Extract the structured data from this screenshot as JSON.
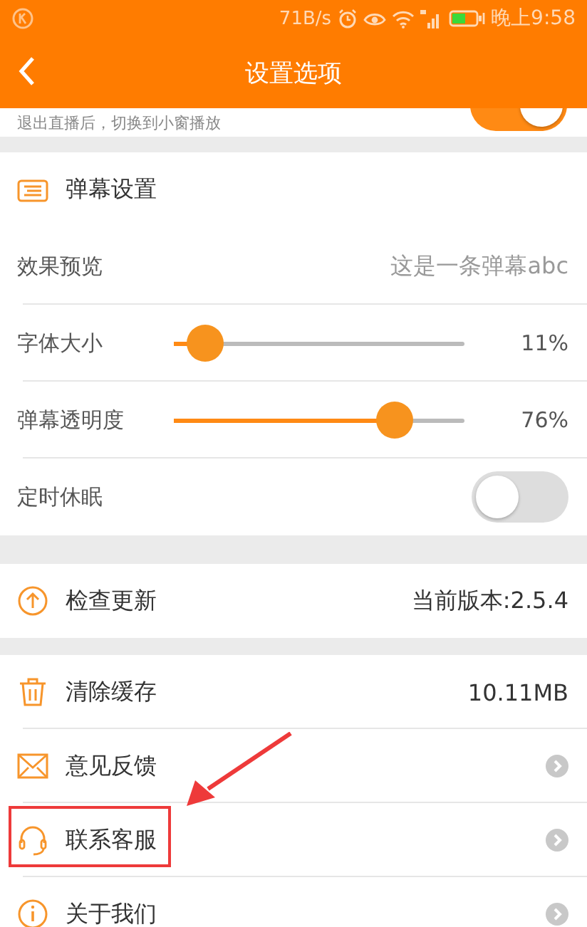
{
  "status_bar": {
    "speed": "71B/s",
    "time": "晚上9:58"
  },
  "header": {
    "title": "设置选项"
  },
  "partial_row": {
    "description": "退出直播后，切换到小窗播放",
    "on": true
  },
  "danmaku": {
    "title": "弹幕设置",
    "rows": [
      {
        "kind": "value",
        "label": "效果预览",
        "value": "这是一条弹幕abc"
      },
      {
        "kind": "slider",
        "label": "字体大小",
        "level": 0.11,
        "reading": "11%"
      },
      {
        "kind": "slider",
        "label": "弹幕透明度",
        "level": 0.76,
        "reading": "76%"
      },
      {
        "kind": "toggle",
        "label": "定时休眠",
        "on": false
      }
    ]
  },
  "update": {
    "label": "检查更新",
    "value": "当前版本:2.5.4"
  },
  "items": [
    {
      "kind": "value",
      "label": "清除缓存",
      "value": "10.11MB",
      "highlighted": false
    },
    {
      "kind": "link",
      "label": "意见反馈",
      "highlighted": false
    },
    {
      "kind": "link",
      "label": "联系客服",
      "highlighted": true
    },
    {
      "kind": "link",
      "label": "关于我们",
      "highlighted": false
    }
  ]
}
